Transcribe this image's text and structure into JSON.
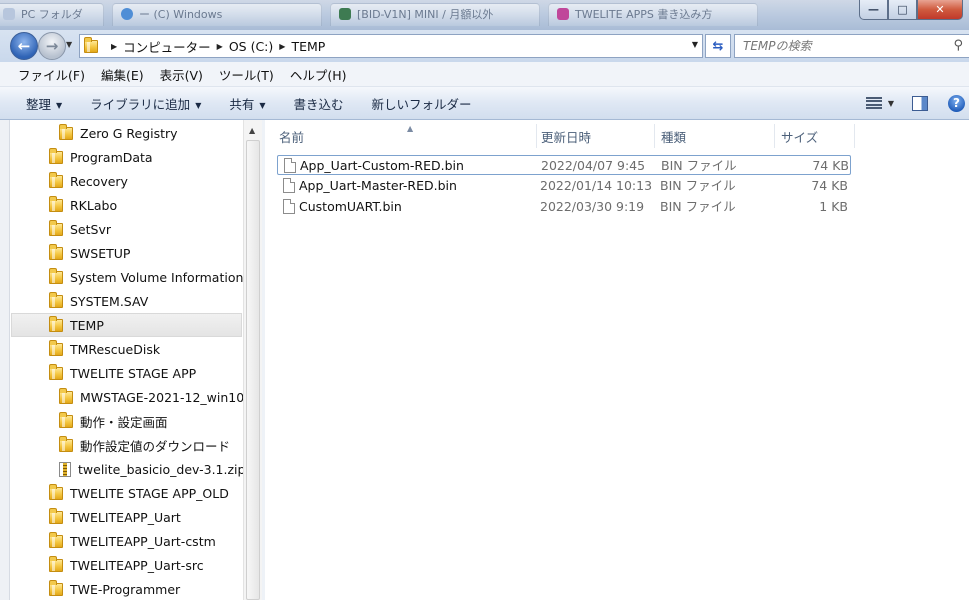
{
  "window": {
    "background_tabs": [
      "PC フォルダ",
      "ー (C) Windows",
      "[BID-V1N] MINI / 月額以外",
      "TWELITE APPS 書き込み方"
    ],
    "minimize": "—",
    "maximize": "□",
    "close": "✕"
  },
  "address": {
    "segments": [
      "コンピューター",
      "OS (C:)",
      "TEMP"
    ]
  },
  "search": {
    "placeholder": "TEMPの検索"
  },
  "menu": [
    "ファイル(F)",
    "編集(E)",
    "表示(V)",
    "ツール(T)",
    "ヘルプ(H)"
  ],
  "toolbar": {
    "organize": "整理",
    "include_library": "ライブラリに追加",
    "share": "共有",
    "burn": "書き込む",
    "new_folder": "新しいフォルダー",
    "help": "?"
  },
  "tree": [
    {
      "label": "Zero G Registry",
      "indent": 1,
      "icon": "folder-icon"
    },
    {
      "label": "ProgramData",
      "indent": 0,
      "icon": "folder-icon"
    },
    {
      "label": "Recovery",
      "indent": 0,
      "icon": "folder-icon"
    },
    {
      "label": "RKLabo",
      "indent": 0,
      "icon": "folder-icon"
    },
    {
      "label": "SetSvr",
      "indent": 0,
      "icon": "folder-icon"
    },
    {
      "label": "SWSETUP",
      "indent": 0,
      "icon": "folder-icon"
    },
    {
      "label": "System Volume Information",
      "indent": 0,
      "icon": "folder-icon"
    },
    {
      "label": "SYSTEM.SAV",
      "indent": 0,
      "icon": "folder-icon"
    },
    {
      "label": "TEMP",
      "indent": 0,
      "icon": "folder-icon",
      "selected": true
    },
    {
      "label": "TMRescueDisk",
      "indent": 0,
      "icon": "folder-icon"
    },
    {
      "label": "TWELITE STAGE APP",
      "indent": 0,
      "icon": "folder-icon"
    },
    {
      "label": "MWSTAGE-2021-12_win10",
      "indent": 1,
      "icon": "folder-icon"
    },
    {
      "label": "動作・設定画面",
      "indent": 1,
      "icon": "folder-icon"
    },
    {
      "label": "動作設定値のダウンロード",
      "indent": 1,
      "icon": "folder-icon"
    },
    {
      "label": "twelite_basicio_dev-3.1.zip",
      "indent": 1,
      "icon": "zip-icon"
    },
    {
      "label": "TWELITE STAGE APP_OLD",
      "indent": 0,
      "icon": "folder-icon"
    },
    {
      "label": "TWELITEAPP_Uart",
      "indent": 0,
      "icon": "folder-icon"
    },
    {
      "label": "TWELITEAPP_Uart-cstm",
      "indent": 0,
      "icon": "folder-icon"
    },
    {
      "label": "TWELITEAPP_Uart-src",
      "indent": 0,
      "icon": "folder-icon"
    },
    {
      "label": "TWE-Programmer",
      "indent": 0,
      "icon": "folder-icon"
    }
  ],
  "columns": [
    "名前",
    "更新日時",
    "種類",
    "サイズ"
  ],
  "files": [
    {
      "name": "App_Uart-Custom-RED.bin",
      "date": "2022/04/07 9:45",
      "type": "BIN ファイル",
      "size": "74 KB",
      "focused": true
    },
    {
      "name": "App_Uart-Master-RED.bin",
      "date": "2022/01/14 10:13",
      "type": "BIN ファイル",
      "size": "74 KB"
    },
    {
      "name": "CustomUART.bin",
      "date": "2022/03/30 9:19",
      "type": "BIN ファイル",
      "size": "1 KB"
    }
  ]
}
